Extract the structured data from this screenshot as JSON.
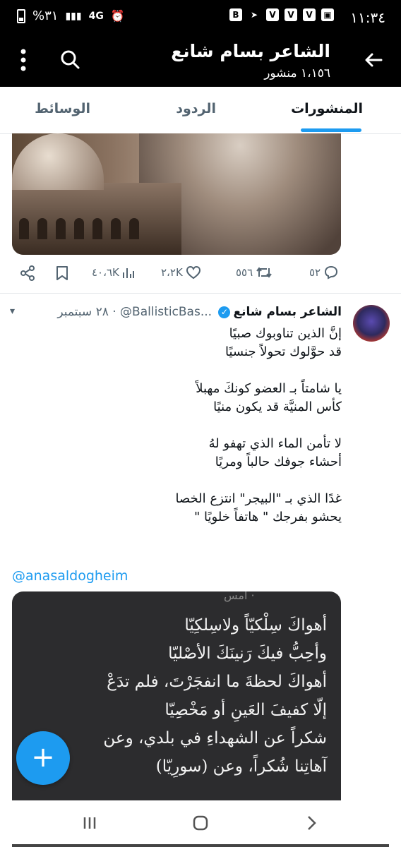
{
  "status_bar": {
    "time": "١١:٣٤",
    "battery": "%٣١",
    "network": "4G"
  },
  "header": {
    "title": "الشاعر بسام شانع",
    "subtitle": "١،١٥٦ منشور"
  },
  "tabs": [
    {
      "label": "المنشورات",
      "active": true
    },
    {
      "label": "الردود",
      "active": false
    },
    {
      "label": "الوسائط",
      "active": false
    }
  ],
  "post_actions": {
    "replies": "٥٢",
    "reposts": "٥٥٦",
    "likes": "٢،٢K",
    "views": "٤٠،٦K"
  },
  "tweet": {
    "name": "الشاعر بسام شانع",
    "handle": "@BallisticBas...",
    "time": "· ٢٨ سبتمبر",
    "poem": "إنَّ الذين تناوبوك صبيًا\nقد حوَّلوك تحولاً جنسيًا\n\nيا شامتاً بـ العضو كونكَ مهبلاً\nكأس المنيَّة قد يكون منيًا\n\nلا تأمن الماء الذي تهفو لهُ\nأحشاء جوفك حالباً ومريًا\n\nغدًا الذي بـ \"البيجر\" انتزع الخصا\nيحشو بفرجك \" هاتفاً خلويًا \"",
    "mention": "@anasaldogheim"
  },
  "quote_image": {
    "header": "أمس ·",
    "text": "أهواكَ سِلْكيّاً ولاسِلكِيّا\nوأحِبُّ فيكَ رَنينَكَ الأصْليّا\nأهواكَ لحظةَ ما انفجَرْتَ، فلم تدَعْ\nإلّا كفيفَ العَينِ أو مَخْصِيّا\nشكراً عن الشهداءِ في بلدي، وعن\nآهاتِنا شُكراً، وعن (سورِيّا)"
  },
  "colors": {
    "accent": "#1d9bf0",
    "header_bg": "#000000",
    "muted_text": "#536471"
  }
}
